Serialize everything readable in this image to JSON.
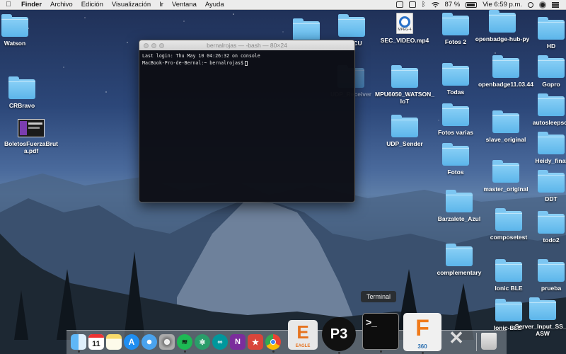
{
  "menubar": {
    "apple_glyph": "",
    "items": [
      "Finder",
      "Archivo",
      "Edición",
      "Visualización",
      "Ir",
      "Ventana",
      "Ayuda"
    ],
    "battery": "87 %",
    "clock": "Vie 6:59 p.m."
  },
  "desktop": {
    "left_items": [
      {
        "label": "Watson",
        "kind": "folder"
      },
      {
        "label": "CRBravo",
        "kind": "folder"
      },
      {
        "label": "BoletosFuerzaBruta.pdf",
        "kind": "pdf"
      }
    ],
    "middle_items": [
      {
        "label": "deMCU",
        "kind": "folder"
      },
      {
        "label": "SEC_VIDEO.mp4",
        "kind": "video"
      },
      {
        "label": "UDP_Receiver",
        "kind": "folder"
      },
      {
        "label": "MPU6050_WATSON_IoT",
        "kind": "folder"
      },
      {
        "label": "UDP_Sender",
        "kind": "folder"
      }
    ],
    "col3_items": [
      {
        "label": "Fotos 2",
        "kind": "folder"
      },
      {
        "label": "Todas",
        "kind": "folder"
      },
      {
        "label": "Fotos varias",
        "kind": "folder"
      },
      {
        "label": "Fotos",
        "kind": "folder"
      },
      {
        "label": "Barzalete_Azul",
        "kind": "folder"
      },
      {
        "label": "complementary",
        "kind": "folder"
      }
    ],
    "col4_items": [
      {
        "label": "openbadge-hub-py",
        "kind": "folder"
      },
      {
        "label": "openbadge11.03.44",
        "kind": "folder"
      },
      {
        "label": "slave_original",
        "kind": "folder"
      },
      {
        "label": "master_original",
        "kind": "folder"
      },
      {
        "label": "composetest",
        "kind": "folder"
      },
      {
        "label": "Ionic BLE",
        "kind": "folder"
      },
      {
        "label": "Ionic-BLE-",
        "kind": "folder"
      }
    ],
    "col5_items": [
      {
        "label": "HD",
        "kind": "folder"
      },
      {
        "label": "Gopro",
        "kind": "folder"
      },
      {
        "label": "autosleepscr",
        "kind": "folder"
      },
      {
        "label": "Heidy_final",
        "kind": "folder"
      },
      {
        "label": "DDT",
        "kind": "folder"
      },
      {
        "label": "todo2",
        "kind": "folder"
      },
      {
        "label": "prueba",
        "kind": "folder"
      },
      {
        "label": "Server_Input_SS_PASW",
        "kind": "folder"
      }
    ],
    "video_badge": "MPEG-4"
  },
  "terminal": {
    "title": "bernalrojas — -bash — 80×24",
    "lines": [
      "Last login: Thu May 10 04:26:32 on console",
      "MacBook-Pro-de-Bernal:~ bernalrojas$"
    ]
  },
  "dock": {
    "tooltip": "Terminal",
    "calendar_day": "11",
    "eagle_label": "EAGLE",
    "fusion_label": "360",
    "terminal_prompt": ">_",
    "apps": [
      "finder",
      "calendar",
      "notes",
      "app-store",
      "safari",
      "system-preferences",
      "spotify",
      "atom",
      "arduino",
      "onenote",
      "wunderlist",
      "chrome",
      "eagle",
      "processing",
      "terminal",
      "fusion-360",
      "xquartz",
      "trash"
    ]
  }
}
